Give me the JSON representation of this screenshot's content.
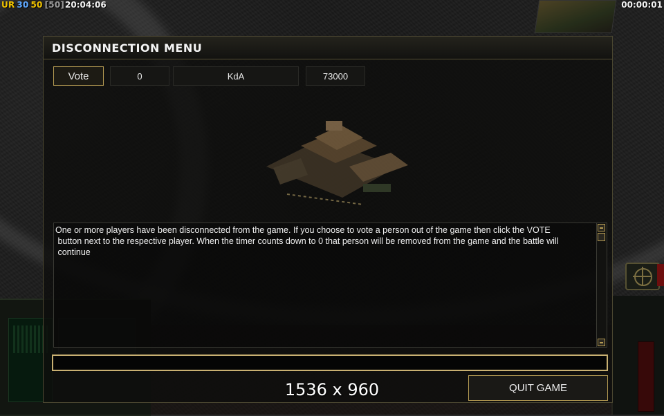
{
  "hud": {
    "fps": [
      {
        "text": "UR",
        "color": "#f2c400"
      },
      {
        "text": "30",
        "color": "#5fa8ff"
      },
      {
        "text": "50",
        "color": "#f2c400"
      },
      {
        "text": "[50]",
        "color": "#9a9a9a"
      }
    ],
    "game_clock": "20:04:06",
    "elapsed_timer": "00:00:01"
  },
  "dialog": {
    "title": "DISCONNECTION MENU",
    "player_row": {
      "vote_label": "Vote",
      "score": "0",
      "name": "KdA",
      "timer": "73000"
    },
    "message": "One or more players have been disconnected from the game. If you choose to vote a person out of the game then click the VOTE\n button next to the respective player. When the timer counts down to 0 that person will be removed from the game and the battle will\n continue",
    "chat_input_value": "",
    "quit_label": "QUIT GAME"
  },
  "resolution_label": "1536 x 960",
  "colors": {
    "accent_border": "#b49a52",
    "input_border": "#c9b072"
  }
}
